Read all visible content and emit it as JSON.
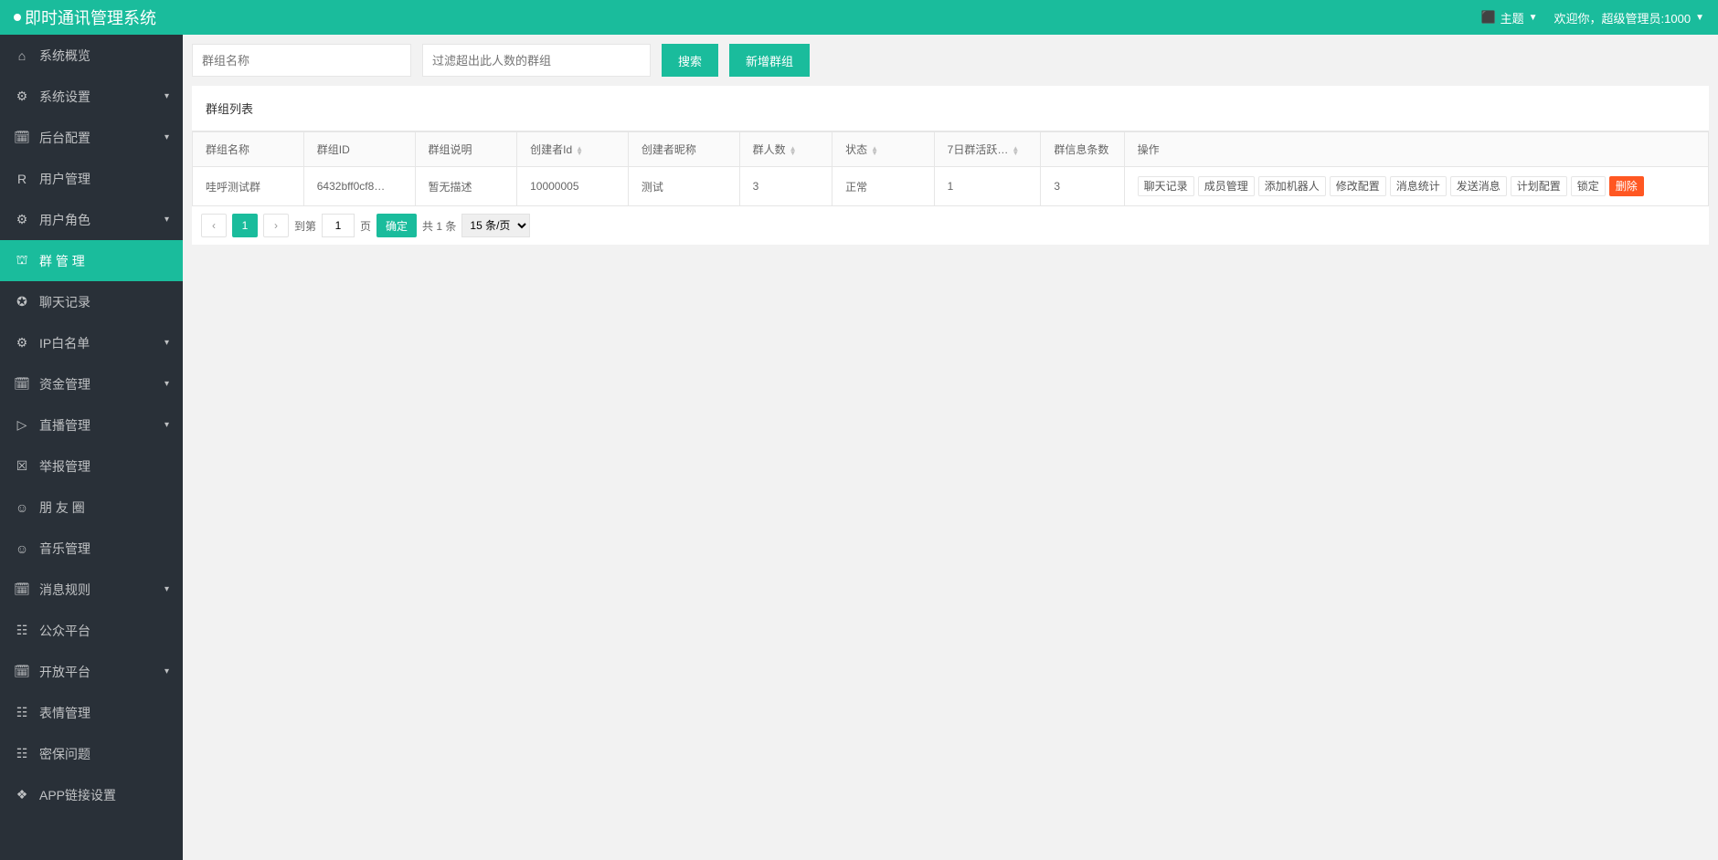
{
  "header": {
    "app_title": "即时通讯管理系统",
    "theme_label": "主题",
    "user_greeting": "欢迎你，超级管理员:1000"
  },
  "sidebar": {
    "items": [
      {
        "icon": "⌂",
        "label": "系统概览",
        "expandable": false,
        "active": false
      },
      {
        "icon": "⚙",
        "label": "系统设置",
        "expandable": true,
        "active": false
      },
      {
        "icon": "🗓",
        "label": "后台配置",
        "expandable": true,
        "active": false
      },
      {
        "icon": "R",
        "label": "用户管理",
        "expandable": false,
        "active": false
      },
      {
        "icon": "⚙",
        "label": "用户角色",
        "expandable": true,
        "active": false
      },
      {
        "icon": "⛫",
        "label": "群 管 理",
        "expandable": false,
        "active": true
      },
      {
        "icon": "✪",
        "label": "聊天记录",
        "expandable": false,
        "active": false
      },
      {
        "icon": "⚙",
        "label": "IP白名单",
        "expandable": true,
        "active": false
      },
      {
        "icon": "🗓",
        "label": "资金管理",
        "expandable": true,
        "active": false
      },
      {
        "icon": "▷",
        "label": "直播管理",
        "expandable": true,
        "active": false
      },
      {
        "icon": "☒",
        "label": "举报管理",
        "expandable": false,
        "active": false
      },
      {
        "icon": "☺",
        "label": "朋 友 圈",
        "expandable": false,
        "active": false
      },
      {
        "icon": "☺",
        "label": "音乐管理",
        "expandable": false,
        "active": false
      },
      {
        "icon": "🗓",
        "label": "消息规则",
        "expandable": true,
        "active": false
      },
      {
        "icon": "☷",
        "label": "公众平台",
        "expandable": false,
        "active": false
      },
      {
        "icon": "🗓",
        "label": "开放平台",
        "expandable": true,
        "active": false
      },
      {
        "icon": "☷",
        "label": "表情管理",
        "expandable": false,
        "active": false
      },
      {
        "icon": "☷",
        "label": "密保问题",
        "expandable": false,
        "active": false
      },
      {
        "icon": "❖",
        "label": "APP链接设置",
        "expandable": false,
        "active": false
      }
    ]
  },
  "search": {
    "name_placeholder": "群组名称",
    "filter_placeholder": "过滤超出此人数的群组",
    "search_btn": "搜索",
    "add_btn": "新增群组"
  },
  "panel": {
    "title": "群组列表"
  },
  "table": {
    "columns": {
      "name": "群组名称",
      "id": "群组ID",
      "desc": "群组说明",
      "creator_id": "创建者Id",
      "creator_name": "创建者昵称",
      "count": "群人数",
      "status": "状态",
      "activity": "7日群活跃…",
      "msg_count": "群信息条数",
      "action": "操作"
    },
    "rows": [
      {
        "name": "哇呼测试群",
        "id": "6432bff0cf8…",
        "desc": "暂无描述",
        "creator_id": "10000005",
        "creator_name": "测试",
        "count": "3",
        "status": "正常",
        "activity": "1",
        "msg_count": "3"
      }
    ],
    "actions": {
      "chat_log": "聊天记录",
      "member_mgmt": "成员管理",
      "add_robot": "添加机器人",
      "modify_config": "修改配置",
      "msg_stats": "消息统计",
      "send_msg": "发送消息",
      "plan_config": "计划配置",
      "lock": "锁定",
      "delete": "删除"
    }
  },
  "pager": {
    "current": "1",
    "goto_label": "到第",
    "goto_value": "1",
    "page_label": "页",
    "confirm": "确定",
    "total": "共 1 条",
    "per_page": "15 条/页"
  }
}
